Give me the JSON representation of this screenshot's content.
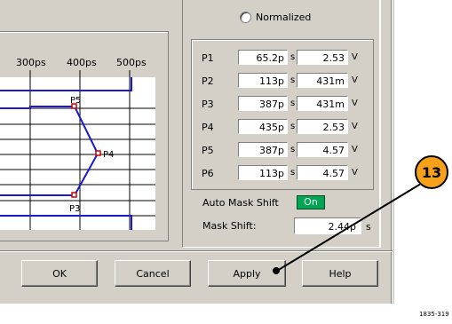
{
  "radio": {
    "label": "Normalized"
  },
  "points": [
    {
      "name": "P1",
      "time": "65.2p",
      "time_unit": "s",
      "volt": "2.53",
      "volt_unit": "V"
    },
    {
      "name": "P2",
      "time": "113p",
      "time_unit": "s",
      "volt": "431m",
      "volt_unit": "V"
    },
    {
      "name": "P3",
      "time": "387p",
      "time_unit": "s",
      "volt": "431m",
      "volt_unit": "V"
    },
    {
      "name": "P4",
      "time": "435p",
      "time_unit": "s",
      "volt": "2.53",
      "volt_unit": "V"
    },
    {
      "name": "P5",
      "time": "387p",
      "time_unit": "s",
      "volt": "4.57",
      "volt_unit": "V"
    },
    {
      "name": "P6",
      "time": "113p",
      "time_unit": "s",
      "volt": "4.57",
      "volt_unit": "V"
    }
  ],
  "auto_mask_shift": {
    "label": "Auto Mask Shift",
    "state": "On"
  },
  "mask_shift": {
    "label": "Mask Shift:",
    "value": "2.44p",
    "unit": "s"
  },
  "plot": {
    "ticks": [
      "300ps",
      "400ps",
      "500ps"
    ],
    "point_labels": {
      "p5": "P5",
      "p4": "P4",
      "p3": "P3"
    }
  },
  "buttons": {
    "ok": "OK",
    "cancel": "Cancel",
    "apply": "Apply",
    "help": "Help"
  },
  "callout": {
    "number": "13"
  },
  "figure_id": "1835-319",
  "colors": {
    "mask_line": "#1a1acc",
    "point_marker": "#cc0000",
    "on_indicator": "#00a651",
    "callout": "#f7a11a"
  }
}
